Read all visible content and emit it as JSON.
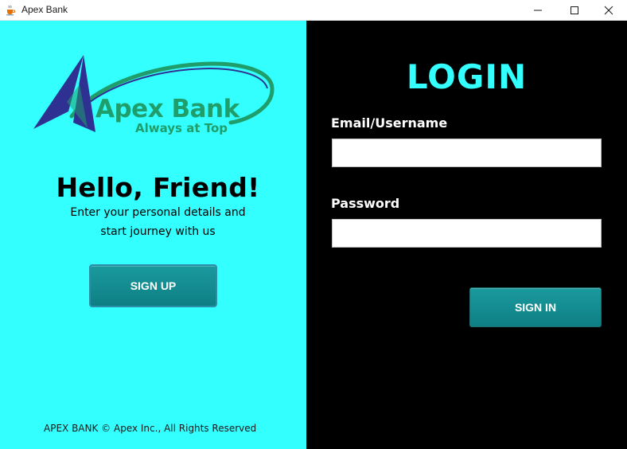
{
  "window": {
    "title": "Apex Bank",
    "icons": {
      "app": "java-cup-icon",
      "minimize": "minimize-icon",
      "maximize": "maximize-icon",
      "close": "close-icon"
    }
  },
  "left_panel": {
    "background": "#33ffff",
    "logo": {
      "name": "Apex Bank",
      "tagline": "Always at Top",
      "icon": "apex-triangle-logo",
      "brand_color": "#1f9e6b",
      "mark_color": "#2e3192"
    },
    "greeting": "Hello, Friend!",
    "subtext": "Enter your personal details and start journey with us",
    "signup_label": "SIGN UP",
    "footer": "APEX BANK © Apex Inc., All Rights Reserved"
  },
  "right_panel": {
    "background": "#000000",
    "title": "LOGIN",
    "title_color": "#33ffff",
    "email_label": "Email/Username",
    "email_value": "",
    "password_label": "Password",
    "password_value": "",
    "signin_label": "SIGN IN",
    "button_color": "#138a8e"
  }
}
